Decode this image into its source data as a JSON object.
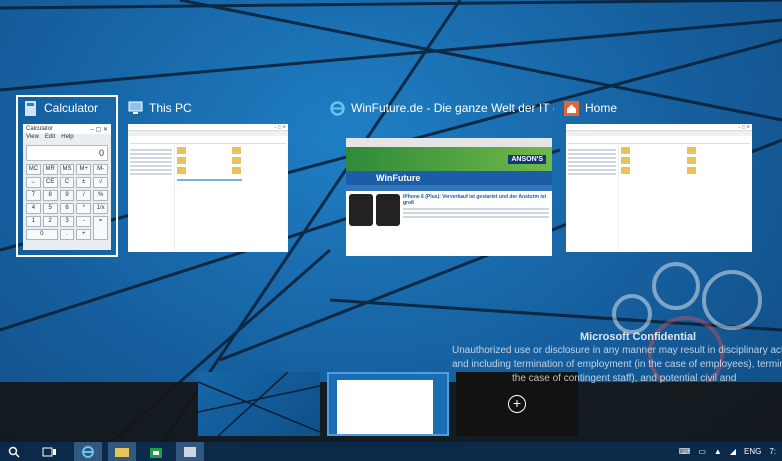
{
  "tasks": [
    {
      "title": "Calculator",
      "icon": "calculator-icon"
    },
    {
      "title": "This PC",
      "icon": "this-pc-icon"
    },
    {
      "title": "WinFuture.de - Die ganze Welt der IT - Int...",
      "icon": "internet-explorer-icon"
    },
    {
      "title": "Home",
      "icon": "home-icon"
    }
  ],
  "calculator": {
    "window_title": "Calculator",
    "menu": [
      "View",
      "Edit",
      "Help"
    ],
    "display": "0",
    "keys": [
      "MC",
      "MR",
      "MS",
      "M+",
      "M-",
      "←",
      "CE",
      "C",
      "±",
      "√",
      "7",
      "8",
      "9",
      "/",
      "%",
      "4",
      "5",
      "6",
      "*",
      "1/x",
      "1",
      "2",
      "3",
      "-",
      "=",
      "0",
      ".",
      "+"
    ]
  },
  "browser": {
    "ad_text": "ANSON'S",
    "logo": "WinFuture",
    "headline": "iPhone 6 (Plus): Ververkauf ist gestartet und der Ansturm ist groß"
  },
  "confidential": {
    "title": "Microsoft Confidential",
    "lines": [
      "Unauthorized use or disclosure in any manner may result in disciplinary action up",
      "and including termination of employment (in the case of employees), termination of",
      "the case of contingent staff), and potential civil and"
    ]
  },
  "taskbar": {
    "items": [
      "search-icon",
      "task-view-icon",
      "internet-explorer-icon",
      "file-explorer-icon",
      "store-icon",
      "app-icon"
    ],
    "language": "ENG",
    "time": "7:"
  },
  "colors": {
    "accent": "#1a6db3",
    "taskbar": "#0b2a4a"
  }
}
